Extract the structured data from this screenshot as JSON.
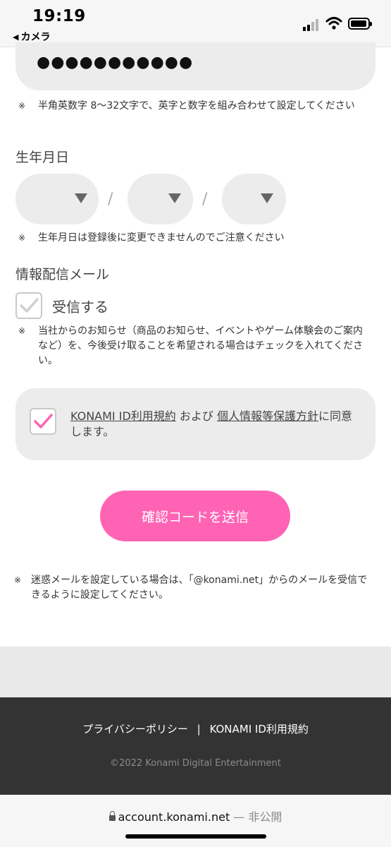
{
  "status_bar": {
    "time": "19:19",
    "back_app": "カメラ",
    "back_icon": "◀"
  },
  "password": {
    "masked_value": "●●●●●●●●●●●",
    "note": "半角英数字 8〜32文字で、英字と数字を組み合わせて設定してください"
  },
  "birthdate": {
    "label": "生年月日",
    "year_value": "",
    "month_value": "",
    "day_value": "",
    "separator": "/",
    "note": "生年月日は登録後に変更できませんのでご注意ください"
  },
  "newsletter": {
    "label": "情報配信メール",
    "checkbox_label": "受信する",
    "checked": true,
    "note": "当社からのお知らせ（商品のお知らせ、イベントやゲーム体験会のご案内など）を、今後受け取ることを希望される場合はチェックを入れてください。"
  },
  "agreement": {
    "checked": true,
    "terms_link": "KONAMI ID利用規約",
    "and_text": " および ",
    "privacy_link": "個人情報等保護方針",
    "suffix": "に同意します。"
  },
  "submit": {
    "label": "確認コードを送信"
  },
  "spam_note": "迷惑メールを設定している場合は、「@konami.net」からのメールを受信できるように設定してください。",
  "note_mark": "※",
  "footer": {
    "privacy_policy": "プライバシーポリシー",
    "separator": "|",
    "terms": "KONAMI ID利用規約",
    "copyright": "©2022 Konami Digital Entertainment"
  },
  "url_bar": {
    "domain": "account.konami.net",
    "status": " — 非公開"
  },
  "colors": {
    "accent": "#ff63b4",
    "field_bg": "#ececec",
    "footer_bg": "#333333"
  }
}
